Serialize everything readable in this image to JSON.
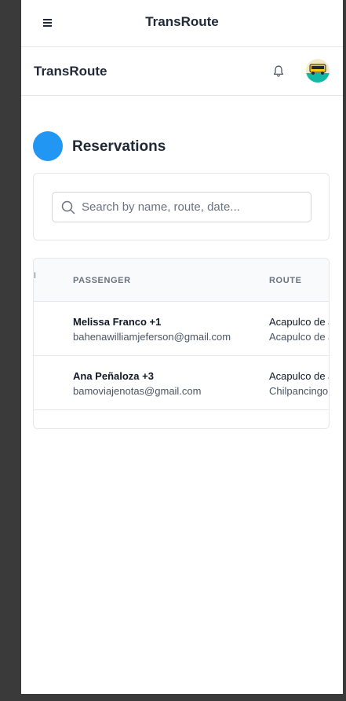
{
  "top_bar": {
    "title": "TransRoute",
    "menu_icon": "hamburger-menu-icon"
  },
  "app_bar": {
    "brand": "TransRoute",
    "notification_icon": "bell-icon",
    "avatar_icon": "bus-logo-avatar"
  },
  "page": {
    "title": "Reservations",
    "accent_color": "#2196f3"
  },
  "search": {
    "placeholder": "Search by name, route, date...",
    "value": "",
    "icon": "search-icon"
  },
  "table": {
    "columns": [
      "PASSENGER",
      "ROUTE"
    ],
    "cut_column_fragment": "I",
    "rows": [
      {
        "passenger": "Melissa Franco +1",
        "email": "bahenawilliamjeferson@gmail.com",
        "route_from": "Acapulco de Juárez",
        "route_to": "Acapulco de Juárez"
      },
      {
        "passenger": "Ana Peñaloza +3",
        "email": "bamoviajenotas@gmail.com",
        "route_from": "Acapulco de Juárez",
        "route_to": "Chilpancingo"
      }
    ]
  }
}
